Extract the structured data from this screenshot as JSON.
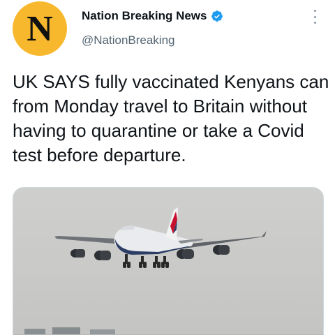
{
  "account": {
    "avatar_letter": "N",
    "display_name": "Nation Breaking News",
    "verified": true,
    "handle": "@NationBreaking"
  },
  "tweet": {
    "text": "UK SAYS fully vaccinated Kenyans can from Monday travel to Britain without having to quarantine or take a Covid test before departure."
  },
  "media": {
    "subject": "airplane-photo"
  },
  "colors": {
    "avatar_bg": "#f7b82d",
    "verified_blue": "#1d9bf0",
    "text_primary": "#0f1419",
    "text_secondary": "#536471"
  },
  "icons": {
    "verified": "verified-badge-icon",
    "more": "more-options-icon"
  }
}
